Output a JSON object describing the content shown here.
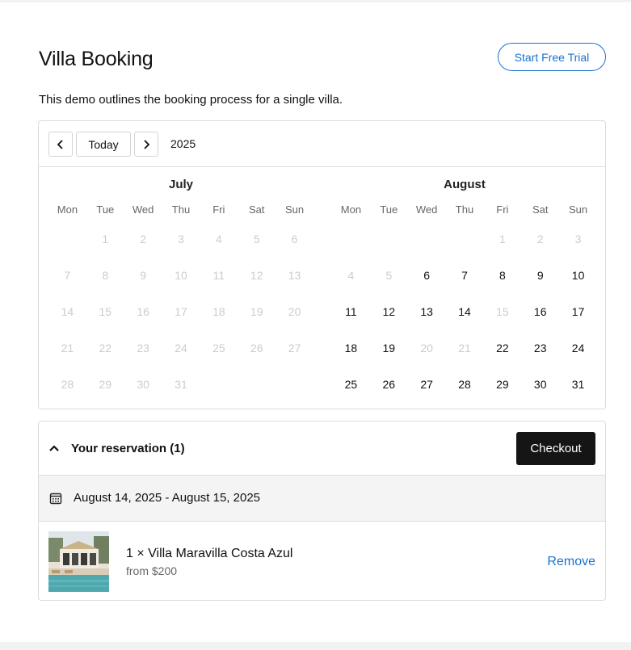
{
  "header": {
    "title": "Villa Booking",
    "trial_button": "Start Free Trial",
    "description": "This demo outlines the booking process for a single villa."
  },
  "calendar": {
    "prev_icon": "chevron-left-icon",
    "next_icon": "chevron-right-icon",
    "today_label": "Today",
    "year": "2025",
    "weekdays": [
      "Mon",
      "Tue",
      "Wed",
      "Thu",
      "Fri",
      "Sat",
      "Sun"
    ],
    "months": [
      {
        "name": "July",
        "offset": 1,
        "days": [
          {
            "d": "1",
            "available": false
          },
          {
            "d": "2",
            "available": false
          },
          {
            "d": "3",
            "available": false
          },
          {
            "d": "4",
            "available": false
          },
          {
            "d": "5",
            "available": false
          },
          {
            "d": "6",
            "available": false
          },
          {
            "d": "7",
            "available": false
          },
          {
            "d": "8",
            "available": false
          },
          {
            "d": "9",
            "available": false
          },
          {
            "d": "10",
            "available": false
          },
          {
            "d": "11",
            "available": false
          },
          {
            "d": "12",
            "available": false
          },
          {
            "d": "13",
            "available": false
          },
          {
            "d": "14",
            "available": false
          },
          {
            "d": "15",
            "available": false
          },
          {
            "d": "16",
            "available": false
          },
          {
            "d": "17",
            "available": false
          },
          {
            "d": "18",
            "available": false
          },
          {
            "d": "19",
            "available": false
          },
          {
            "d": "20",
            "available": false
          },
          {
            "d": "21",
            "available": false
          },
          {
            "d": "22",
            "available": false
          },
          {
            "d": "23",
            "available": false
          },
          {
            "d": "24",
            "available": false
          },
          {
            "d": "25",
            "available": false
          },
          {
            "d": "26",
            "available": false
          },
          {
            "d": "27",
            "available": false
          },
          {
            "d": "28",
            "available": false
          },
          {
            "d": "29",
            "available": false
          },
          {
            "d": "30",
            "available": false
          },
          {
            "d": "31",
            "available": false
          }
        ]
      },
      {
        "name": "August",
        "offset": 4,
        "days": [
          {
            "d": "1",
            "available": false
          },
          {
            "d": "2",
            "available": false
          },
          {
            "d": "3",
            "available": false
          },
          {
            "d": "4",
            "available": false
          },
          {
            "d": "5",
            "available": false
          },
          {
            "d": "6",
            "available": true
          },
          {
            "d": "7",
            "available": true
          },
          {
            "d": "8",
            "available": true
          },
          {
            "d": "9",
            "available": true
          },
          {
            "d": "10",
            "available": true
          },
          {
            "d": "11",
            "available": true
          },
          {
            "d": "12",
            "available": true
          },
          {
            "d": "13",
            "available": true
          },
          {
            "d": "14",
            "available": true
          },
          {
            "d": "15",
            "available": false
          },
          {
            "d": "16",
            "available": true
          },
          {
            "d": "17",
            "available": true
          },
          {
            "d": "18",
            "available": true
          },
          {
            "d": "19",
            "available": true
          },
          {
            "d": "20",
            "available": false
          },
          {
            "d": "21",
            "available": false
          },
          {
            "d": "22",
            "available": true
          },
          {
            "d": "23",
            "available": true
          },
          {
            "d": "24",
            "available": true
          },
          {
            "d": "25",
            "available": true
          },
          {
            "d": "26",
            "available": true
          },
          {
            "d": "27",
            "available": true
          },
          {
            "d": "28",
            "available": true
          },
          {
            "d": "29",
            "available": true
          },
          {
            "d": "30",
            "available": true
          },
          {
            "d": "31",
            "available": true
          }
        ]
      }
    ]
  },
  "reservation": {
    "toggle_icon": "chevron-up-icon",
    "title": "Your reservation (1)",
    "checkout_label": "Checkout",
    "date_icon": "calendar-icon",
    "date_range": "August 14, 2025 - August 15, 2025",
    "item": {
      "thumbnail": "villa-photo",
      "name": "1 × Villa Maravilla Costa Azul",
      "price": "from $200",
      "remove_label": "Remove"
    }
  },
  "colors": {
    "accent": "#1a73d0",
    "checkout_bg": "#151515",
    "disabled_day": "#cccccc",
    "border": "#dcdcdc"
  }
}
